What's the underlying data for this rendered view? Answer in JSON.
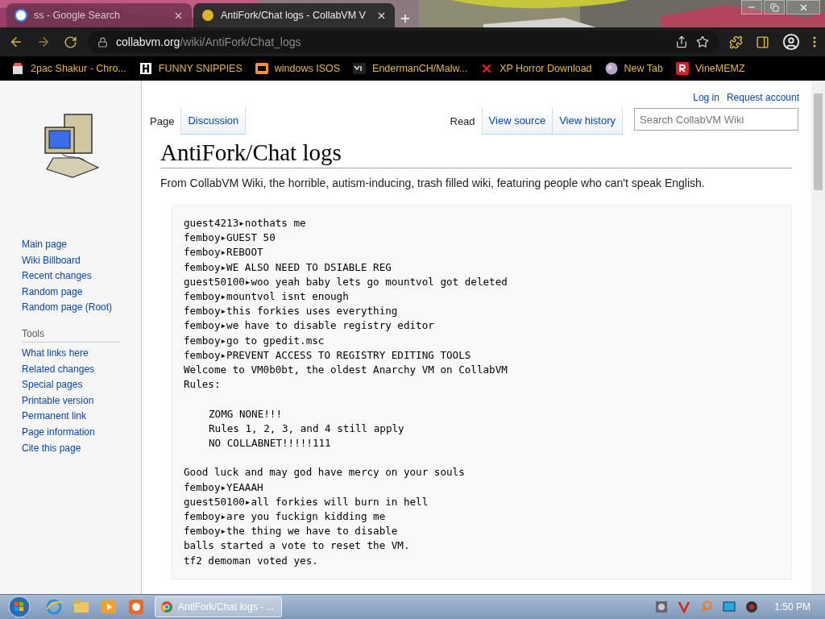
{
  "browser": {
    "tabs": [
      {
        "title": "ss - Google Search",
        "selected": false
      },
      {
        "title": "AntiFork/Chat logs - CollabVM V",
        "selected": true
      }
    ],
    "address": {
      "domain": "collabvm.org",
      "path": "/wiki/AntiFork/Chat_logs"
    },
    "bookmarks": [
      {
        "label": "2pac Shakur - Chro..."
      },
      {
        "label": "FUNNY SNIPPIES"
      },
      {
        "label": "windows ISOS"
      },
      {
        "label": "EndermanCH/Malw..."
      },
      {
        "label": "XP Horror Download"
      },
      {
        "label": "New Tab"
      },
      {
        "label": "VineMEMZ"
      }
    ]
  },
  "page": {
    "personal": [
      "Log in",
      "Request account"
    ],
    "tabs_left": [
      {
        "label": "Page",
        "selected": true
      },
      {
        "label": "Discussion",
        "selected": false
      }
    ],
    "tabs_right": [
      {
        "label": "Read",
        "selected": true
      },
      {
        "label": "View source",
        "selected": false
      },
      {
        "label": "View history",
        "selected": false
      }
    ],
    "search": {
      "placeholder": "Search CollabVM Wiki"
    },
    "title": "AntiFork/Chat logs",
    "tagline": "From CollabVM Wiki, the horrible, autism-inducing, trash filled wiki, featuring people who can't speak English.",
    "navigation": [
      "Main page",
      "Wiki Billboard",
      "Recent changes",
      "Random page",
      "Random page (Root)"
    ],
    "tools": {
      "heading": "Tools",
      "items": [
        "What links here",
        "Related changes",
        "Special pages",
        "Printable version",
        "Permanent link",
        "Page information",
        "Cite this page"
      ]
    },
    "log": [
      {
        "kind": "line",
        "text": "guest4213▸nothats me"
      },
      {
        "kind": "line",
        "text": "femboy▸GUEST 50"
      },
      {
        "kind": "line",
        "text": "femboy▸REBOOT"
      },
      {
        "kind": "line",
        "text": "femboy▸WE ALSO NEED TO DSIABLE REG"
      },
      {
        "kind": "line",
        "text": "guest50100▸woo yeah baby lets go mountvol got deleted"
      },
      {
        "kind": "line",
        "text": "femboy▸mountvol isnt enough"
      },
      {
        "kind": "line",
        "text": "femboy▸this forkies uses everything"
      },
      {
        "kind": "line",
        "text": "femboy▸we have to disable registry editor"
      },
      {
        "kind": "line",
        "text": "femboy▸go to gpedit.msc"
      },
      {
        "kind": "line",
        "text": "femboy▸PREVENT ACCESS TO REGISTRY EDITING TOOLS"
      },
      {
        "kind": "line",
        "text": "Welcome to VM0b0bt, the oldest Anarchy VM on CollabVM"
      },
      {
        "kind": "line",
        "text": "Rules:"
      },
      {
        "kind": "blank"
      },
      {
        "kind": "indented",
        "text": "ZOMG NONE!!!"
      },
      {
        "kind": "indented",
        "text": "Rules 1, 2, 3, and 4 still apply"
      },
      {
        "kind": "indented",
        "text": "NO COLLABNET!!!!!111"
      },
      {
        "kind": "blank"
      },
      {
        "kind": "line",
        "text": "Good luck and may god have mercy on your souls"
      },
      {
        "kind": "line",
        "text": "femboy▸YEAAAH"
      },
      {
        "kind": "line",
        "text": "guest50100▸all forkies will burn in hell"
      },
      {
        "kind": "line",
        "text": "femboy▸are you fuckign kidding me"
      },
      {
        "kind": "line",
        "text": "femboy▸the thing we have to disable"
      },
      {
        "kind": "line",
        "text": "balls started a vote to reset the VM."
      },
      {
        "kind": "line",
        "text": "tf2 demoman voted yes."
      }
    ]
  },
  "taskbar": {
    "windows": [
      {
        "title": "AntiFork/Chat logs - ...",
        "selected": true
      }
    ],
    "clock": "1:50 PM"
  }
}
